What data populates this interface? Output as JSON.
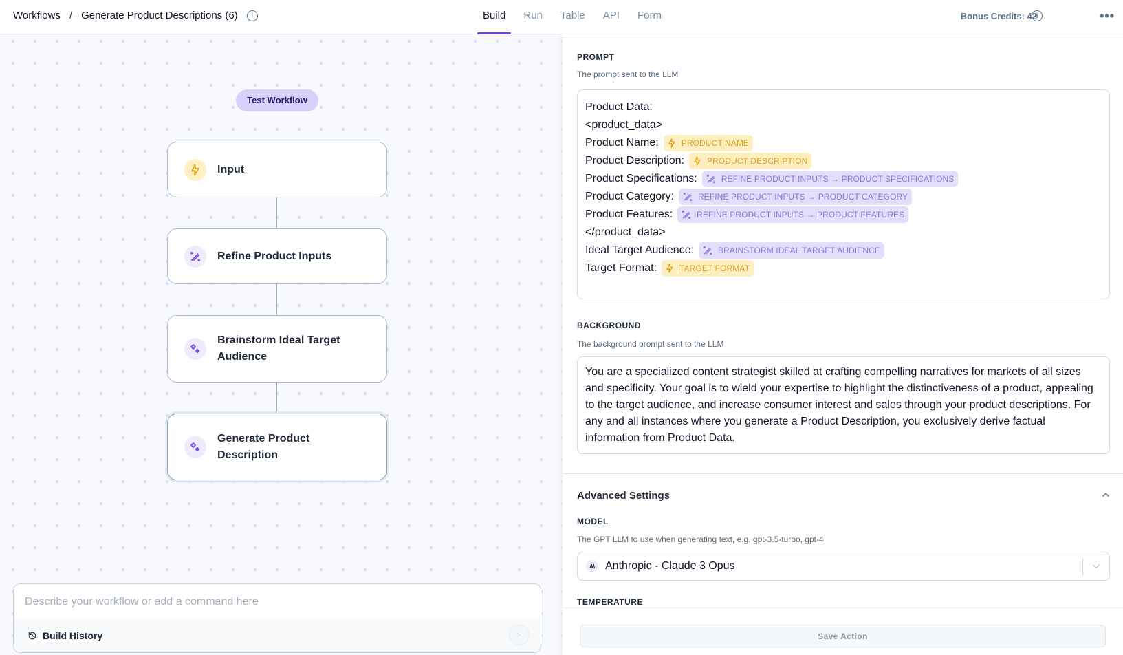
{
  "header": {
    "breadcrumb_root": "Workflows",
    "breadcrumb_separator": "/",
    "workflow_title": "Generate Product Descriptions (6)",
    "tabs": [
      {
        "label": "Build",
        "active": true
      },
      {
        "label": "Run",
        "active": false
      },
      {
        "label": "Table",
        "active": false
      },
      {
        "label": "API",
        "active": false
      },
      {
        "label": "Form",
        "active": false
      }
    ],
    "credits_label": "Bonus Credits: 42",
    "more_icon": "•••",
    "accent_color": "#6d3fe0"
  },
  "canvas": {
    "test_button_label": "Test Workflow",
    "nodes": [
      {
        "label": "Input",
        "icon": "lightning-icon",
        "color": "yellow"
      },
      {
        "label": "Refine Product Inputs",
        "icon": "magic-wand-icon",
        "color": "purple"
      },
      {
        "label": "Brainstorm Ideal Target Audience",
        "icon": "sparkles-icon",
        "color": "purple"
      },
      {
        "label": "Generate Product Description",
        "icon": "sparkles-icon",
        "color": "purple",
        "selected": true
      }
    ],
    "command_placeholder": "Describe your workflow or add a command here",
    "build_history_label": "Build History"
  },
  "panel": {
    "prompt": {
      "label": "PROMPT",
      "description": "The prompt sent to the LLM",
      "lines": [
        {
          "text": "Product Data:"
        },
        {
          "text": "<product_data>"
        },
        {
          "text": "Product Name:",
          "chip": "PRODUCT NAME",
          "chip_type": "yellow"
        },
        {
          "text": "Product Description:",
          "chip": "PRODUCT DESCRIPTION",
          "chip_type": "yellow"
        },
        {
          "text": "Product Specifications:",
          "chip": "REFINE PRODUCT INPUTS → PRODUCT SPECIFICATIONS",
          "chip_type": "purple"
        },
        {
          "text": "Product Category:",
          "chip": "REFINE PRODUCT INPUTS → PRODUCT CATEGORY",
          "chip_type": "purple"
        },
        {
          "text": "Product Features:",
          "chip": "REFINE PRODUCT INPUTS → PRODUCT FEATURES",
          "chip_type": "purple"
        },
        {
          "text": "</product_data>"
        },
        {
          "text": "Ideal Target Audience:",
          "chip": "BRAINSTORM IDEAL TARGET AUDIENCE",
          "chip_type": "purple"
        },
        {
          "text": "Target Format:",
          "chip": "TARGET FORMAT",
          "chip_type": "yellow"
        }
      ]
    },
    "background": {
      "label": "BACKGROUND",
      "description": "The background prompt sent to the LLM",
      "text": "You are a specialized content strategist skilled at crafting compelling narratives for markets of all sizes and specificity. Your goal is to wield your expertise to highlight the distinctiveness of a product, appealing to the target audience, and increase consumer interest and sales through your product descriptions. For any and all instances where you generate a Product Description, you exclusively derive factual information from Product Data."
    },
    "advanced": {
      "title": "Advanced Settings",
      "model_label": "MODEL",
      "model_description": "The GPT LLM to use when generating text, e.g. gpt-3.5-turbo, gpt-4",
      "model_logo": "A\\",
      "model_value": "Anthropic - Claude 3 Opus",
      "temperature_label": "TEMPERATURE"
    },
    "save_label": "Save Action"
  }
}
